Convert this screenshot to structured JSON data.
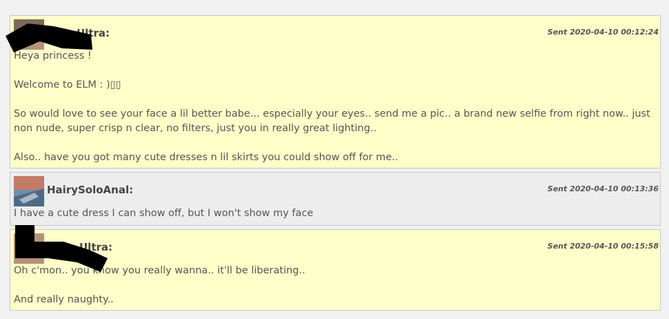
{
  "messages": [
    {
      "author": "Ultra:",
      "sent": "Sent 2020-04-10 00:12:24",
      "paragraphs": [
        "Heya princess !",
        "Welcome to ELM : )▯▯",
        "So would love to see your face a lil better babe... especially your eyes.. send me a pic.. a brand new selfie from right now.. just non nude, super crisp n clear, no filters, just you in really great lighting..",
        "Also.. have you got many cute dresses n lil skirts you could show off for me.."
      ]
    },
    {
      "author": "HairySoloAnal:",
      "sent": "Sent 2020-04-10 00:13:36",
      "paragraphs": [
        "I have a cute dress I can show off, but I won't show my face"
      ]
    },
    {
      "author": "Ultra:",
      "sent": "Sent 2020-04-10 00:15:58",
      "paragraphs": [
        "Oh c'mon.. you know you really wanna.. it'll be liberating..",
        "And really naughty.."
      ]
    }
  ],
  "colors": {
    "page_bg": "#f1f1f1",
    "yellow_bg": "#fefec9",
    "grey_bg": "#ededed",
    "border": "#c8c8c8",
    "redaction": "#000000"
  }
}
